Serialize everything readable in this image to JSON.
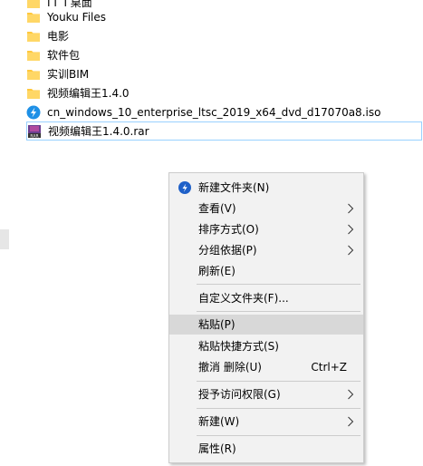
{
  "files": [
    {
      "name": "ГГ Г桌面",
      "type": "folder"
    },
    {
      "name": "Youku Files",
      "type": "folder"
    },
    {
      "name": "电影",
      "type": "folder"
    },
    {
      "name": "软件包",
      "type": "folder"
    },
    {
      "name": "实训BIM",
      "type": "folder"
    },
    {
      "name": "视频编辑王1.4.0",
      "type": "folder"
    },
    {
      "name": "cn_windows_10_enterprise_ltsc_2019_x64_dvd_d17070a8.iso",
      "type": "iso"
    },
    {
      "name": "视频编辑王1.4.0.rar",
      "type": "rar"
    }
  ],
  "context_menu": {
    "new_folder": "新建文件夹(N)",
    "view": "查看(V)",
    "sort_by": "排序方式(O)",
    "group_by": "分组依据(P)",
    "refresh": "刷新(E)",
    "customize_folder": "自定义文件夹(F)...",
    "paste": "粘贴(P)",
    "paste_shortcut": "粘贴快捷方式(S)",
    "undo_delete": "撤消 删除(U)",
    "undo_shortcut": "Ctrl+Z",
    "grant_access": "授予访问权限(G)",
    "new": "新建(W)",
    "properties": "属性(R)"
  },
  "colors": {
    "folder": "#ffc83d",
    "iso_icon": "#1e90e6",
    "selection_border": "#99d1ff",
    "menu_bg": "#f2f2f2",
    "menu_hover": "#d8d8d8"
  }
}
